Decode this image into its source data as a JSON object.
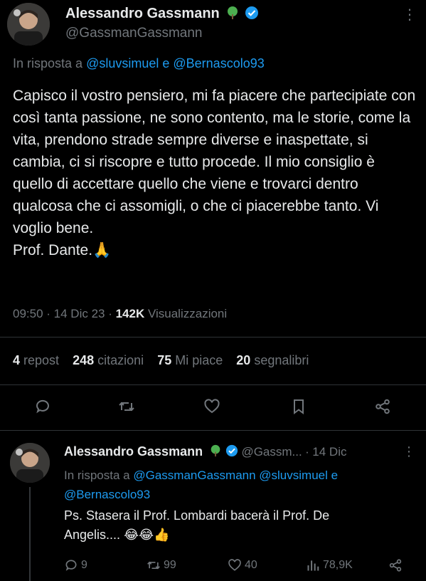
{
  "main_tweet": {
    "author_name": "Alessandro Gassmann",
    "author_handle": "@GassmanGassmann",
    "reply_prefix": "In risposta a",
    "reply_mentions": "@sluvsimuel e @Bernascolo93",
    "text": "Capisco il vostro pensiero, mi fa piacere che partecipiate con così tanta passione, ne sono contento, ma le storie, come la vita, prendono strade sempre diverse e inaspettate, si cambia, ci si riscopre e tutto procede. Il mio consiglio è quello di accettare quello che viene e trovarci dentro qualcosa che ci assomigli, o che ci piacerebbe tanto. Vi voglio bene.",
    "signature": "Prof. Dante.🙏",
    "time": "09:50",
    "date": "14 Dic 23",
    "views_count": "142K",
    "views_label": "Visualizzazioni",
    "stats": {
      "reposts_count": "4",
      "reposts_label": "repost",
      "quotes_count": "248",
      "quotes_label": "citazioni",
      "likes_count": "75",
      "likes_label": "Mi piace",
      "bookmarks_count": "20",
      "bookmarks_label": "segnalibri"
    },
    "icons": {
      "reply": "reply-icon",
      "repost": "repost-icon",
      "like": "like-icon",
      "bookmark": "bookmark-icon",
      "share": "share-icon"
    }
  },
  "reply_tweet": {
    "author_name": "Alessandro Gassmann",
    "author_handle": "@Gassm...",
    "separator": "·",
    "date": "14 Dic",
    "reply_prefix": "In risposta a",
    "reply_mentions_line1": "@GassmanGassmann @sluvsimuel e",
    "reply_mentions_line2": "@Bernascolo93",
    "text_line1": "Ps. Stasera il Prof. Lombardi bacerà il Prof. De",
    "text_line2": "Angelis....",
    "emojis": "😂😂👍",
    "replies": "9",
    "reposts": "99",
    "likes": "40",
    "views": "78,9K"
  },
  "colors": {
    "background": "#000000",
    "text": "#e7e9ea",
    "muted": "#71767b",
    "link": "#1d9bf0",
    "verified": "#1d9bf0",
    "tree_badge": "#4caf50"
  }
}
